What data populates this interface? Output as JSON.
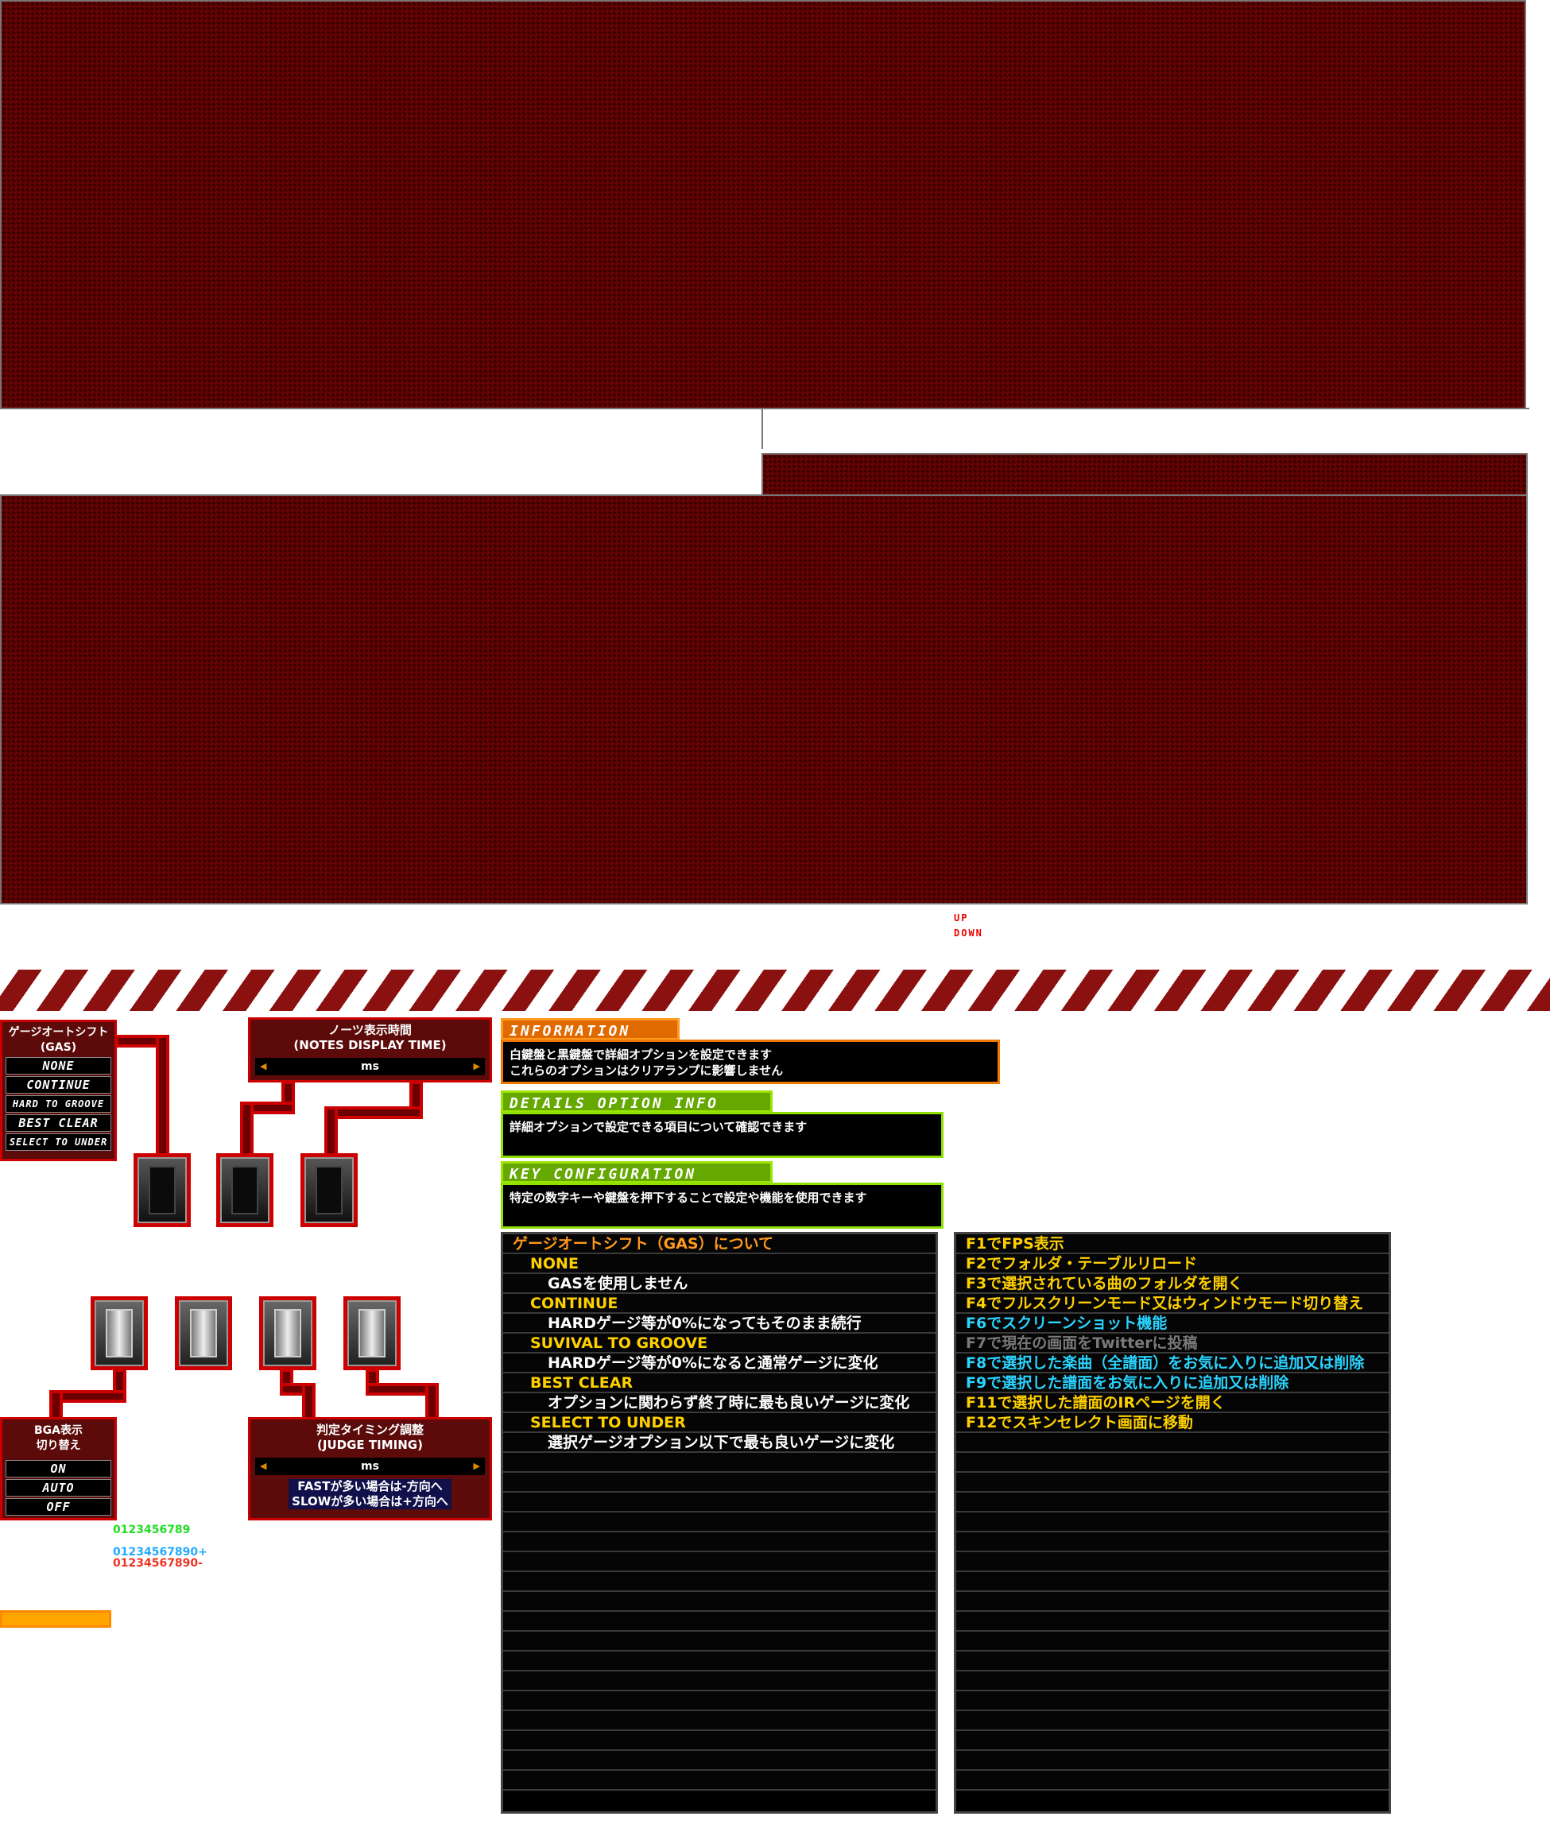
{
  "updown": {
    "up": "UP",
    "down": "DOWN"
  },
  "gas_panel": {
    "title": "ゲージオートシフト\n(GAS)",
    "options": [
      "NONE",
      "CONTINUE",
      "HARD TO GROOVE",
      "BEST CLEAR",
      "SELECT TO UNDER"
    ]
  },
  "notes_panel": {
    "title": "ノーツ表示時間\n(NOTES DISPLAY TIME)",
    "unit": "ms"
  },
  "bga_panel": {
    "title": "BGA表示\n切り替え",
    "options": [
      "ON",
      "AUTO",
      "OFF"
    ]
  },
  "judge_panel": {
    "title": "判定タイミング調整\n(JUDGE TIMING)",
    "unit": "ms",
    "hint1": "FASTが多い場合は-方向へ",
    "hint2": "SLOWが多い場合は+方向へ"
  },
  "digits": {
    "green": "0123456789",
    "cyan": "01234567890+",
    "red": "01234567890-"
  },
  "information": {
    "tab": "INFORMATION",
    "line1": "白鍵盤と黒鍵盤で詳細オプションを設定できます",
    "line2": "これらのオプションはクリアランプに影響しません"
  },
  "details": {
    "tab": "DETAILS OPTION INFO",
    "line1": "詳細オプションで設定できる項目について確認できます"
  },
  "keyconfig": {
    "tab": "KEY CONFIGURATION",
    "line1": "特定の数字キーや鍵盤を押下することで設定や機能を使用できます"
  },
  "gas_help": [
    {
      "text": "ゲージオートシフト（GAS）について",
      "color": "orange",
      "indent": 0
    },
    {
      "text": "NONE",
      "color": "yellow",
      "indent": 1
    },
    {
      "text": "GASを使用しません",
      "color": "white",
      "indent": 2
    },
    {
      "text": "CONTINUE",
      "color": "yellow",
      "indent": 1
    },
    {
      "text": "HARDゲージ等が0%になってもそのまま続行",
      "color": "white",
      "indent": 2
    },
    {
      "text": "SUVIVAL TO GROOVE",
      "color": "yellow",
      "indent": 1
    },
    {
      "text": "HARDゲージ等が0%になると通常ゲージに変化",
      "color": "white",
      "indent": 2
    },
    {
      "text": "BEST CLEAR",
      "color": "yellow",
      "indent": 1
    },
    {
      "text": "オプションに関わらず終了時に最も良いゲージに変化",
      "color": "white",
      "indent": 2
    },
    {
      "text": "SELECT TO UNDER",
      "color": "yellow",
      "indent": 1
    },
    {
      "text": "選択ゲージオプション以下で最も良いゲージに変化",
      "color": "white",
      "indent": 2
    }
  ],
  "fkeys": [
    {
      "text": "F1でFPS表示",
      "color": "yellow"
    },
    {
      "text": "F2でフォルダ・テーブルリロード",
      "color": "yellow"
    },
    {
      "text": "F3で選択されている曲のフォルダを開く",
      "color": "yellow"
    },
    {
      "text": "F4でフルスクリーンモード又はウィンドウモード切り替え",
      "color": "yellow"
    },
    {
      "text": "F6でスクリーンショット機能",
      "color": "cyan"
    },
    {
      "text": "F7で現在の画面をTwitterに投稿",
      "color": "gray"
    },
    {
      "text": "F8で選択した楽曲（全譜面）をお気に入りに追加又は削除",
      "color": "cyan"
    },
    {
      "text": "F9で選択した譜面をお気に入りに追加又は削除",
      "color": "cyan"
    },
    {
      "text": "F11で選択した譜面のIRページを開く",
      "color": "yellow"
    },
    {
      "text": "F12でスキンセレクト画面に移動",
      "color": "yellow"
    }
  ],
  "colors": {
    "accent_red": "#cc0000",
    "information_tab": "#f07800",
    "details_tab": "#8fe000",
    "keyconfig_tab": "#8fe000"
  }
}
